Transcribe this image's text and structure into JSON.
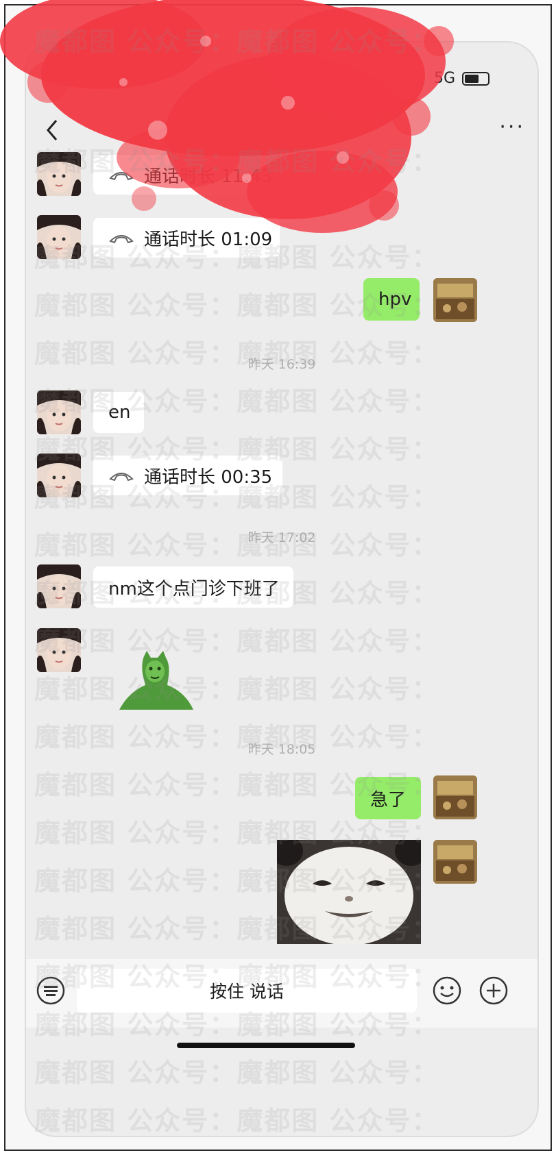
{
  "status_bar": {
    "network": "5G"
  },
  "header": {
    "back_label": "<",
    "title": "",
    "more_label": "···"
  },
  "messages": {
    "m1": {
      "call_label": "通话时长 11:43"
    },
    "m2": {
      "call_label": "通话时长 01:09"
    },
    "m3": {
      "text": "hpv"
    },
    "t1": {
      "text": "昨天 16:39"
    },
    "m4": {
      "text": "en"
    },
    "m5": {
      "call_label": "通话时长 00:35"
    },
    "t2": {
      "text": "昨天 17:02"
    },
    "m6": {
      "text": "nm这个点门诊下班了"
    },
    "t3": {
      "text": "昨天 18:05"
    },
    "m8": {
      "text": "急了"
    }
  },
  "input_bar": {
    "hold_to_talk": "按住 说话"
  },
  "watermark_text": "魔都图  公众号：魔都图  公众号：",
  "colors": {
    "chat_bg": "#ededed",
    "outgoing": "#95ec69",
    "incoming": "#ffffff",
    "blot": "#f23a45"
  },
  "icons": {
    "back": "chevron-left-icon",
    "more": "more-icon",
    "call": "phone-call-icon",
    "voice": "voice-keyboard-icon",
    "emoji": "emoji-icon",
    "plus": "plus-icon"
  }
}
